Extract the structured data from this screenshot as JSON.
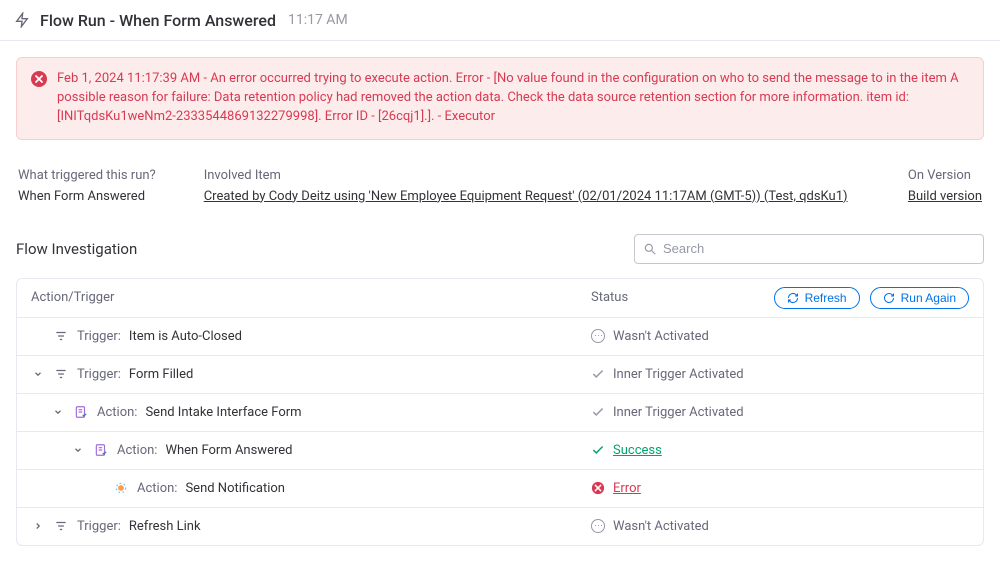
{
  "header": {
    "title": "Flow Run - When Form Answered",
    "timestamp": "11:17 AM"
  },
  "error": {
    "message": "Feb 1, 2024 11:17:39 AM - An error occurred trying to execute action. Error - [No value found in the configuration on who to send the message to in the item A possible reason for failure: Data retention policy had removed the action data. Check the data source retention section for more information. item id: [INITqdsKu1weNm2-2333544869132279998]. Error ID - [26cqj1].]. - Executor"
  },
  "meta": {
    "trigger_label": "What triggered this run?",
    "trigger_value": "When Form Answered",
    "item_label": "Involved Item",
    "item_value": "Created by Cody Deitz using 'New Employee Equipment Request' (02/01/2024 11:17AM (GMT-5)) (Test, qdsKu1)",
    "version_label": "On Version",
    "version_value": "Build version"
  },
  "investigation": {
    "title": "Flow Investigation",
    "search_placeholder": "Search",
    "action_col": "Action/Trigger",
    "status_col": "Status",
    "refresh_btn": "Refresh",
    "run_again_btn": "Run Again"
  },
  "rows": [
    {
      "prefix": "Trigger:",
      "name": "Item is Auto-Closed",
      "status_text": "Wasn't Activated",
      "status_kind": "inactive"
    },
    {
      "prefix": "Trigger:",
      "name": "Form Filled",
      "status_text": "Inner Trigger Activated",
      "status_kind": "check-gray"
    },
    {
      "prefix": "Action:",
      "name": "Send Intake Interface Form",
      "status_text": "Inner Trigger Activated",
      "status_kind": "check-gray"
    },
    {
      "prefix": "Action:",
      "name": "When Form Answered",
      "status_text": "Success",
      "status_kind": "success"
    },
    {
      "prefix": "Action:",
      "name": "Send Notification",
      "status_text": "Error",
      "status_kind": "error"
    },
    {
      "prefix": "Trigger:",
      "name": "Refresh Link",
      "status_text": "Wasn't Activated",
      "status_kind": "inactive"
    }
  ]
}
